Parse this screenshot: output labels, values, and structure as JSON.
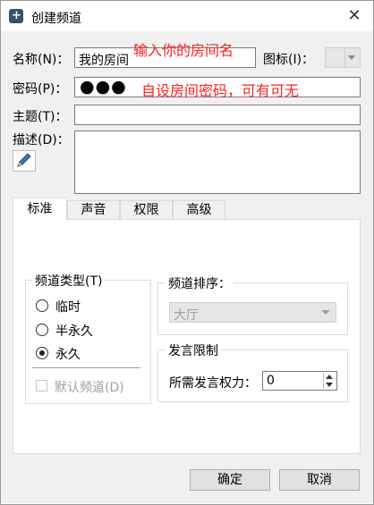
{
  "window": {
    "title": "创建频道",
    "icon": "channel-add-icon",
    "close_glyph": "✕"
  },
  "form": {
    "name_label": "名称(N)：",
    "name_value": "我的房间",
    "name_annotation": "输入你的房间名",
    "icon_label": "图标(I)：",
    "password_label": "密码(P)：",
    "password_mask": "●●●",
    "password_annotation": "自设房间密码，可有可无",
    "topic_label": "主题(T)：",
    "topic_value": "",
    "desc_label": "描述(D)：",
    "desc_value": "",
    "annotation_color": "#ff2020"
  },
  "tabs": [
    {
      "label": "标准",
      "active": true
    },
    {
      "label": "声音",
      "active": false
    },
    {
      "label": "权限",
      "active": false
    },
    {
      "label": "高级",
      "active": false
    }
  ],
  "channel_type": {
    "title": "频道类型(T)",
    "options": [
      {
        "label": "临时",
        "checked": false
      },
      {
        "label": "半永久",
        "checked": false
      },
      {
        "label": "永久",
        "checked": true
      }
    ],
    "default_channel_label": "默认频道(D)",
    "default_channel_checked": false
  },
  "sort": {
    "title": "频道排序：",
    "selected": "大厅"
  },
  "speak_limit": {
    "title": "发言限制",
    "power_label": "所需发言权力：",
    "power_value": "0"
  },
  "buttons": {
    "ok": "确定",
    "cancel": "取消"
  }
}
